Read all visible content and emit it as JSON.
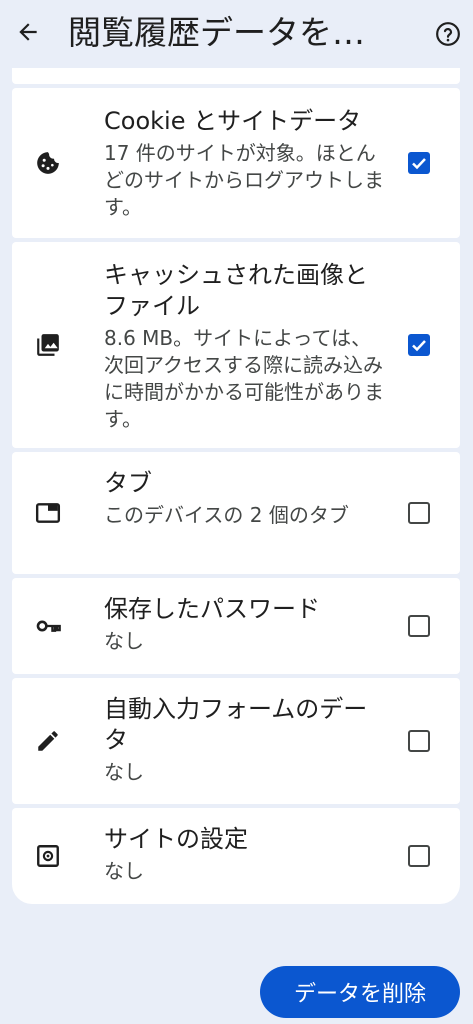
{
  "header": {
    "title": "閲覧履歴データを…"
  },
  "items": [
    {
      "label": "Cookie とサイトデータ",
      "description": "17 件のサイトが対象。ほとんどのサイトからログアウトします。",
      "checked": true,
      "icon": "cookie-icon"
    },
    {
      "label": "キャッシュされた画像とファイル",
      "description": "8.6 MB。サイトによっては、次回アクセスする際に読み込みに時間がかかる可能性があります。",
      "checked": true,
      "icon": "image-stack-icon"
    },
    {
      "label": "タブ",
      "description": "このデバイスの 2 個のタブ",
      "checked": false,
      "icon": "tab-icon"
    },
    {
      "label": "保存したパスワード",
      "description": "なし",
      "checked": false,
      "icon": "key-icon"
    },
    {
      "label": "自動入力フォームのデータ",
      "description": "なし",
      "checked": false,
      "icon": "pencil-icon"
    },
    {
      "label": "サイトの設定",
      "description": "なし",
      "checked": false,
      "icon": "site-settings-icon"
    }
  ],
  "footer": {
    "delete_label": "データを削除"
  },
  "colors": {
    "accent": "#0b57d0",
    "background": "#e9eef8",
    "card": "#ffffff"
  }
}
